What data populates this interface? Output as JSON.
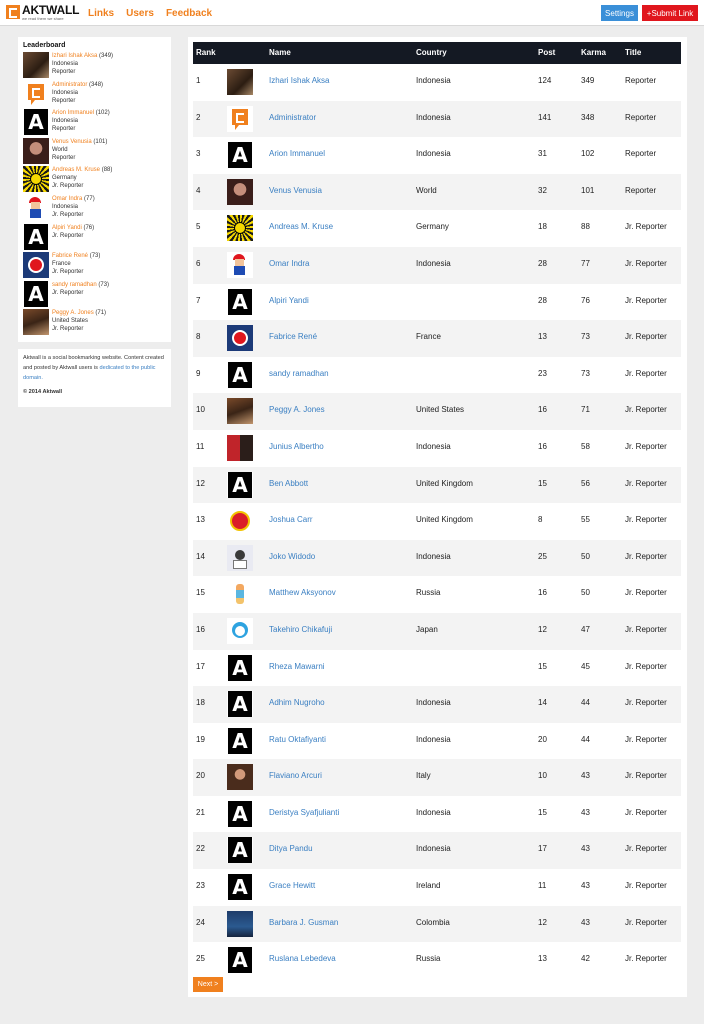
{
  "header": {
    "logo_name": "AKTWALL",
    "logo_tagline": "we read them we share",
    "nav": [
      "Links",
      "Users",
      "Feedback"
    ],
    "settings_label": "Settings",
    "submit_label": "+Submit Link"
  },
  "sidebar": {
    "leaderboard_title": "Leaderboard",
    "leaders": [
      {
        "name": "Izhari Ishak Aksa",
        "karma": "(349)",
        "country": "Indonesia",
        "title": "Reporter",
        "avatar": "photo-brown"
      },
      {
        "name": "Administrator",
        "karma": "(348)",
        "country": "Indonesia",
        "title": "Reporter",
        "avatar": "aktwall"
      },
      {
        "name": "Arion Immanuel",
        "karma": "(102)",
        "country": "Indonesia",
        "title": "Reporter",
        "avatar": "A"
      },
      {
        "name": "Venus Venusia",
        "karma": "(101)",
        "country": "World",
        "title": "Reporter",
        "avatar": "photo-venus"
      },
      {
        "name": "Andreas M. Kruse",
        "karma": "(88)",
        "country": "Germany",
        "title": "Jr. Reporter",
        "avatar": "bvb"
      },
      {
        "name": "Omar Indra",
        "karma": "(77)",
        "country": "Indonesia",
        "title": "Jr. Reporter",
        "avatar": "mario"
      },
      {
        "name": "Alpiri Yandi",
        "karma": "(76)",
        "country": "",
        "title": "Jr. Reporter",
        "avatar": "A"
      },
      {
        "name": "Fabrice René",
        "karma": "(73)",
        "country": "France",
        "title": "Jr. Reporter",
        "avatar": "psg"
      },
      {
        "name": "sandy ramadhan",
        "karma": "(73)",
        "country": "",
        "title": "Jr. Reporter",
        "avatar": "A"
      },
      {
        "name": "Peggy A. Jones",
        "karma": "(71)",
        "country": "United States",
        "title": "Jr. Reporter",
        "avatar": "peggy"
      }
    ],
    "about_text": "Aktwall is a social bookmarking website. Content created and posted by Aktwall users is",
    "about_link": "dedicated to the public domain.",
    "copyright": "© 2014 Aktwall"
  },
  "table": {
    "headers": {
      "rank": "Rank",
      "name": "Name",
      "country": "Country",
      "post": "Post",
      "karma": "Karma",
      "title": "Title"
    },
    "rows": [
      {
        "rank": "1",
        "avatar": "photo-brown",
        "name": "Izhari Ishak Aksa",
        "country": "Indonesia",
        "post": "124",
        "karma": "349",
        "title": "Reporter"
      },
      {
        "rank": "2",
        "avatar": "aktwall",
        "name": "Administrator",
        "country": "Indonesia",
        "post": "141",
        "karma": "348",
        "title": "Reporter"
      },
      {
        "rank": "3",
        "avatar": "A",
        "name": "Arion Immanuel",
        "country": "Indonesia",
        "post": "31",
        "karma": "102",
        "title": "Reporter"
      },
      {
        "rank": "4",
        "avatar": "photo-venus",
        "name": "Venus Venusia",
        "country": "World",
        "post": "32",
        "karma": "101",
        "title": "Reporter"
      },
      {
        "rank": "5",
        "avatar": "bvb",
        "name": "Andreas M. Kruse",
        "country": "Germany",
        "post": "18",
        "karma": "88",
        "title": "Jr. Reporter"
      },
      {
        "rank": "6",
        "avatar": "mario",
        "name": "Omar Indra",
        "country": "Indonesia",
        "post": "28",
        "karma": "77",
        "title": "Jr. Reporter"
      },
      {
        "rank": "7",
        "avatar": "A",
        "name": "Alpiri Yandi",
        "country": "",
        "post": "28",
        "karma": "76",
        "title": "Jr. Reporter"
      },
      {
        "rank": "8",
        "avatar": "psg",
        "name": "Fabrice René",
        "country": "France",
        "post": "13",
        "karma": "73",
        "title": "Jr. Reporter"
      },
      {
        "rank": "9",
        "avatar": "A",
        "name": "sandy ramadhan",
        "country": "",
        "post": "23",
        "karma": "73",
        "title": "Jr. Reporter"
      },
      {
        "rank": "10",
        "avatar": "peggy",
        "name": "Peggy A. Jones",
        "country": "United States",
        "post": "16",
        "karma": "71",
        "title": "Jr. Reporter"
      },
      {
        "rank": "11",
        "avatar": "junius",
        "name": "Junius Albertho",
        "country": "Indonesia",
        "post": "16",
        "karma": "58",
        "title": "Jr. Reporter"
      },
      {
        "rank": "12",
        "avatar": "A",
        "name": "Ben Abbott",
        "country": "United Kingdom",
        "post": "15",
        "karma": "56",
        "title": "Jr. Reporter"
      },
      {
        "rank": "13",
        "avatar": "manu",
        "name": "Joshua Carr",
        "country": "United Kingdom",
        "post": "8",
        "karma": "55",
        "title": "Jr. Reporter"
      },
      {
        "rank": "14",
        "avatar": "joko",
        "name": "Joko Widodo",
        "country": "Indonesia",
        "post": "25",
        "karma": "50",
        "title": "Jr. Reporter"
      },
      {
        "rank": "15",
        "avatar": "matthew",
        "name": "Matthew Aksyonov",
        "country": "Russia",
        "post": "16",
        "karma": "50",
        "title": "Jr. Reporter"
      },
      {
        "rank": "16",
        "avatar": "doraemon",
        "name": "Takehiro Chikafuji",
        "country": "Japan",
        "post": "12",
        "karma": "47",
        "title": "Jr. Reporter"
      },
      {
        "rank": "17",
        "avatar": "A",
        "name": "Rheza Mawarni",
        "country": "",
        "post": "15",
        "karma": "45",
        "title": "Jr. Reporter"
      },
      {
        "rank": "18",
        "avatar": "A",
        "name": "Adhim Nugroho",
        "country": "Indonesia",
        "post": "14",
        "karma": "44",
        "title": "Jr. Reporter"
      },
      {
        "rank": "19",
        "avatar": "A",
        "name": "Ratu Oktafiyanti",
        "country": "Indonesia",
        "post": "20",
        "karma": "44",
        "title": "Jr. Reporter"
      },
      {
        "rank": "20",
        "avatar": "flaviano",
        "name": "Flaviano Arcuri",
        "country": "Italy",
        "post": "10",
        "karma": "43",
        "title": "Jr. Reporter"
      },
      {
        "rank": "21",
        "avatar": "A",
        "name": "Deristya Syafjulianti",
        "country": "Indonesia",
        "post": "15",
        "karma": "43",
        "title": "Jr. Reporter"
      },
      {
        "rank": "22",
        "avatar": "A",
        "name": "Ditya Pandu",
        "country": "Indonesia",
        "post": "17",
        "karma": "43",
        "title": "Jr. Reporter"
      },
      {
        "rank": "23",
        "avatar": "A",
        "name": "Grace Hewitt",
        "country": "Ireland",
        "post": "11",
        "karma": "43",
        "title": "Jr. Reporter"
      },
      {
        "rank": "24",
        "avatar": "barbara",
        "name": "Barbara J. Gusman",
        "country": "Colombia",
        "post": "12",
        "karma": "43",
        "title": "Jr. Reporter"
      },
      {
        "rank": "25",
        "avatar": "A",
        "name": "Ruslana Lebedeva",
        "country": "Russia",
        "post": "13",
        "karma": "42",
        "title": "Jr. Reporter"
      }
    ],
    "next_label": "Next >"
  },
  "colors": {
    "accent": "#f0801e",
    "link": "#3a7fc2",
    "header_bg": "#141923",
    "settings": "#3a8fd8",
    "submit": "#e0161d"
  }
}
